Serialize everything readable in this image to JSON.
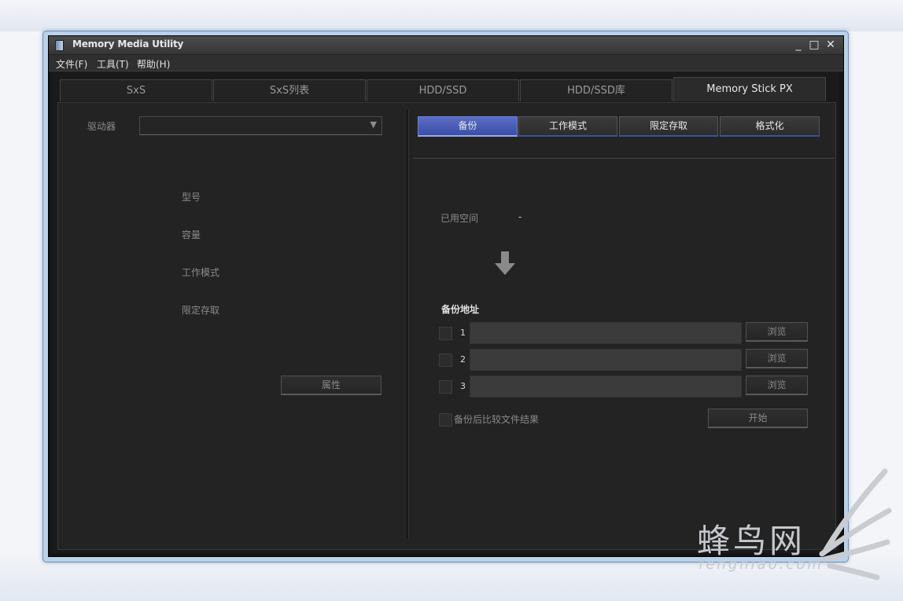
{
  "window": {
    "title": "Memory Media Utility",
    "minimize": "_",
    "maximize": "□",
    "close": "✕"
  },
  "menu": [
    "文件(F)",
    "工具(T)",
    "帮助(H)"
  ],
  "tabs": [
    "SxS",
    "SxS列表",
    "HDD/SSD",
    "HDD/SSD库",
    "Memory Stick PX"
  ],
  "active_tab": "Memory Stick PX",
  "left": {
    "drive_label": "驱动器",
    "drive_value": "",
    "info_labels": [
      "型号",
      "容量",
      "工作模式",
      "限定存取"
    ],
    "properties_button": "属性"
  },
  "right": {
    "segments": [
      "备份",
      "工作模式",
      "限定存取",
      "格式化"
    ],
    "active_segment": "备份",
    "used_space_label": "已用空间",
    "used_space_value": "-",
    "backup_title": "备份地址",
    "destinations": [
      {
        "index": "1",
        "path": "",
        "browse": "浏览"
      },
      {
        "index": "2",
        "path": "",
        "browse": "浏览"
      },
      {
        "index": "3",
        "path": "",
        "browse": "浏览"
      }
    ],
    "compare_label": "备份后比较文件结果",
    "start_button": "开始"
  },
  "watermark": {
    "main": "蜂鸟网",
    "sub": "fengniao.com"
  },
  "colors": {
    "accent": "#4a5db5",
    "background": "#232323",
    "window_frame": "#b9d1ea"
  }
}
